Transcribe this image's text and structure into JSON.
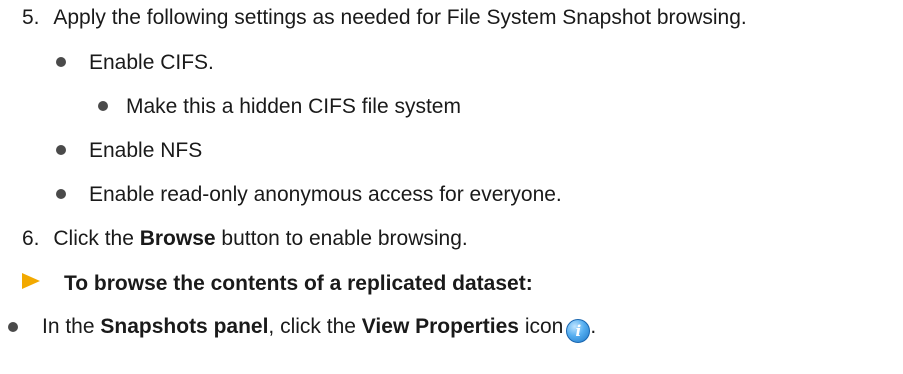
{
  "steps": [
    {
      "number": "5.",
      "text": "Apply the following settings as needed for File System Snapshot browsing.",
      "bullets": [
        {
          "text": "Enable CIFS.",
          "sub": [
            "Make this a hidden CIFS file system"
          ]
        },
        {
          "text": "Enable NFS"
        },
        {
          "text": "Enable read-only anonymous access for everyone."
        }
      ]
    },
    {
      "number": "6.",
      "pre": "Click the ",
      "bold": "Browse",
      "post": " button to enable browsing."
    }
  ],
  "procedure": {
    "heading": "To browse the contents of a replicated dataset:",
    "bullet": {
      "pre": "In the ",
      "bold1": "Snapshots panel",
      "mid": ", click the ",
      "bold2": "View Properties",
      "post": " icon",
      "icon": "info-icon",
      "end": "."
    }
  }
}
